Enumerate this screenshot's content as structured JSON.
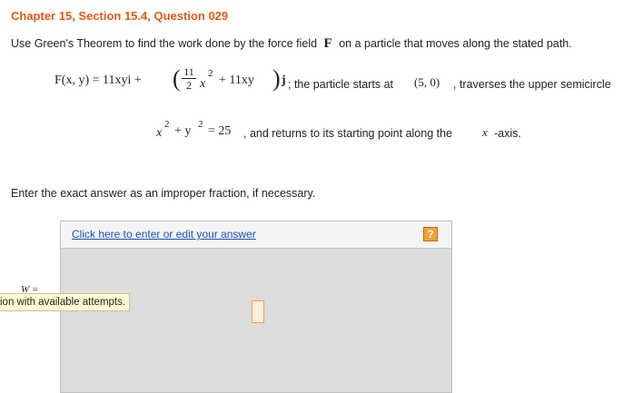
{
  "header": {
    "title": "Chapter 15, Section 15.4, Question 029"
  },
  "question": {
    "intro": "Use Green's Theorem to find the work done by the force field",
    "intro_symbol": "F",
    "intro_end": "on a particle that moves along the stated path.",
    "formula_lhs": "F(x, y) = 11xyi +",
    "frac_num": "11",
    "frac_den": "2",
    "formula_x2": "x",
    "sup2": "2",
    "formula_mid": "+ 11xy",
    "formula_j": "j",
    "semi_text": "; the particle starts at",
    "start_point": "(5, 0)",
    "path_text": ", traverses the upper semicircle",
    "circle_eq_x": "x",
    "circle_eq_plus": "+ y",
    "circle_eq_rhs": "= 25",
    "return_text": ", and returns to its starting point along the",
    "axis_symbol": "x",
    "axis_text": "-axis."
  },
  "instruction": "Enter the exact answer as an improper fraction, if necessary.",
  "answer_panel": {
    "link_label": "Click here to enter or edit your answer",
    "help_label": "?",
    "variable_label": "W =",
    "tooltip": "ion with available attempts."
  },
  "colors": {
    "title": "#e05a12",
    "link": "#1a4fb8",
    "help": "#f0a23a",
    "panel": "#dcdcdc"
  }
}
